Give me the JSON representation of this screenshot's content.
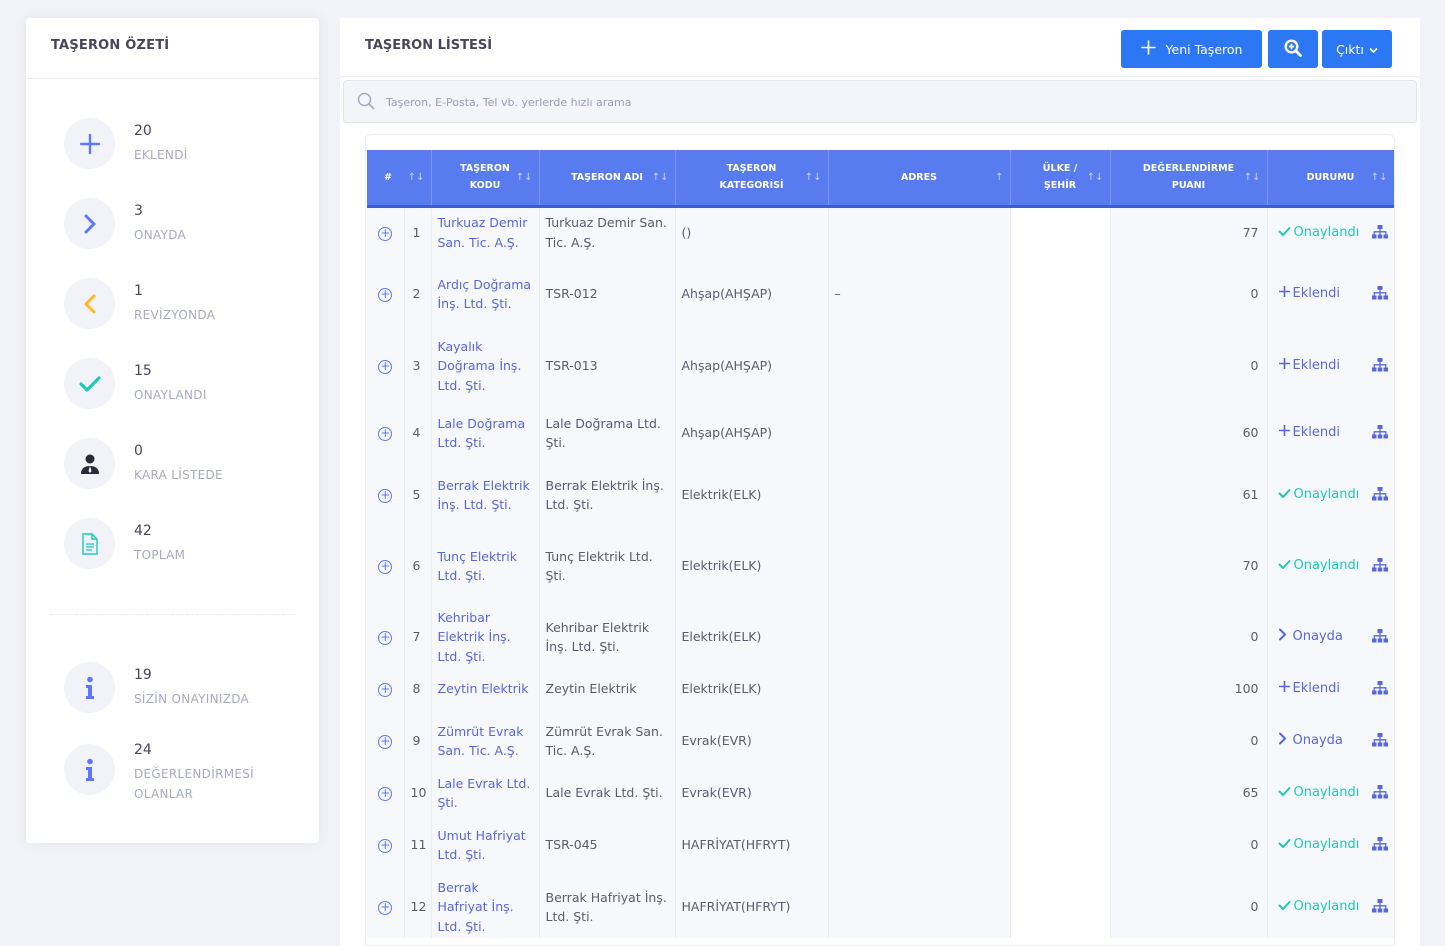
{
  "summary": {
    "title": "TAŞERON ÖZETİ",
    "stats": [
      {
        "icon": "plus-icon",
        "count": "20",
        "label": "EKLENDİ"
      },
      {
        "icon": "chevron-right-icon",
        "count": "3",
        "label": "ONAYDA"
      },
      {
        "icon": "chevron-left-icon",
        "count": "1",
        "label": "REVİZYONDA"
      },
      {
        "icon": "check-icon",
        "count": "15",
        "label": "ONAYLANDI"
      },
      {
        "icon": "user-tie-icon",
        "count": "0",
        "label": "KARA LİSTEDE"
      },
      {
        "icon": "document-icon",
        "count": "42",
        "label": "TOPLAM"
      },
      {
        "icon": "info-icon",
        "count": "19",
        "label": "SİZİN ONAYINIZDA"
      },
      {
        "icon": "info-icon",
        "count": "24",
        "label_line1": "DEĞERLENDİRMESİ",
        "label_line2": "OLANLAR"
      }
    ]
  },
  "main": {
    "title": "TAŞERON LİSTESİ",
    "new_button": "Yeni Taşeron",
    "output_button": "Çıktı",
    "search_placeholder": "Taşeron, E-Posta, Tel vb. yerlerde hızlı arama"
  },
  "table": {
    "headers": {
      "num": "#",
      "code_1": "TAŞERON",
      "code_2": "KODU",
      "name": "TAŞERON ADI",
      "cat_1": "TAŞERON",
      "cat_2": "KATEGORİSİ",
      "addr": "ADRES",
      "city_1": "ÜLKE /",
      "city_2": "ŞEHİR",
      "score_1": "DEĞERLENDİRME",
      "score_2": "PUANI",
      "status": "DURUMU"
    },
    "rows": [
      {
        "n": "1",
        "code": "Turkuaz Demir San. Tic. A.Ş.",
        "name": "Turkuaz Demir San. Tic. A.Ş.",
        "cat": "()",
        "addr": "",
        "score": "77",
        "status": "Onaylandı",
        "kind": "onay"
      },
      {
        "n": "2",
        "code": "Ardıç Doğrama İnş. Ltd. Şti.",
        "name": "TSR-012",
        "cat": "Ahşap(AHŞAP)",
        "addr": "–",
        "score": "0",
        "status": "Eklendi",
        "kind": "ekl"
      },
      {
        "n": "3",
        "code": "Kayalık Doğrama İnş. Ltd. Şti.",
        "name": "TSR-013",
        "cat": "Ahşap(AHŞAP)",
        "addr": "",
        "score": "0",
        "status": "Eklendi",
        "kind": "ekl"
      },
      {
        "n": "4",
        "code": "Lale Doğrama Ltd. Şti.",
        "name": "Lale Doğrama Ltd. Şti.",
        "cat": "Ahşap(AHŞAP)",
        "addr": "",
        "score": "60",
        "status": "Eklendi",
        "kind": "ekl"
      },
      {
        "n": "5",
        "code": "Berrak Elektrik İnş. Ltd. Şti.",
        "name": "Berrak Elektrik İnş. Ltd. Şti.",
        "cat": "Elektrik(ELK)",
        "addr": "",
        "score": "61",
        "status": "Onaylandı",
        "kind": "onay"
      },
      {
        "n": "6",
        "code": "Tunç Elektrik Ltd. Şti.",
        "name": "Tunç Elektrik Ltd. Şti.",
        "cat": "Elektrik(ELK)",
        "addr": "",
        "score": "70",
        "status": "Onaylandı",
        "kind": "onay"
      },
      {
        "n": "7",
        "code": "Kehribar Elektrik İnş. Ltd. Şti.",
        "name": "Kehribar Elektrik İnş. Ltd. Şti.",
        "cat": "Elektrik(ELK)",
        "addr": "",
        "score": "0",
        "status": "Onayda",
        "kind": "onayda"
      },
      {
        "n": "8",
        "code": "Zeytin Elektrik",
        "name": "Zeytin Elektrik",
        "cat": "Elektrik(ELK)",
        "addr": "",
        "score": "100",
        "status": "Eklendi",
        "kind": "ekl"
      },
      {
        "n": "9",
        "code": "Zümrüt Evrak San. Tic. A.Ş.",
        "name": "Zümrüt Evrak San. Tic. A.Ş.",
        "cat": "Evrak(EVR)",
        "addr": "",
        "score": "0",
        "status": "Onayda",
        "kind": "onayda"
      },
      {
        "n": "10",
        "code": "Lale Evrak Ltd. Şti.",
        "name": "Lale Evrak Ltd. Şti.",
        "cat": "Evrak(EVR)",
        "addr": "",
        "score": "65",
        "status": "Onaylandı",
        "kind": "onay"
      },
      {
        "n": "11",
        "code": "Umut Hafriyat Ltd. Şti.",
        "name": "TSR-045",
        "cat": "HAFRİYAT(HFRYT)",
        "addr": "",
        "score": "0",
        "status": "Onaylandı",
        "kind": "onay"
      },
      {
        "n": "12",
        "code": "Berrak Hafriyat İnş. Ltd. Şti.",
        "name": "Berrak Hafriyat İnş. Ltd. Şti.",
        "cat": "HAFRİYAT(HFRYT)",
        "addr": "",
        "score": "0",
        "status": "Onaylandı",
        "kind": "onay"
      }
    ]
  },
  "colors": {
    "primary": "#2c77f4",
    "table_header": "#587cf0",
    "approved": "#1dc9b7",
    "link": "#5867dd",
    "warning": "#ffb822"
  }
}
